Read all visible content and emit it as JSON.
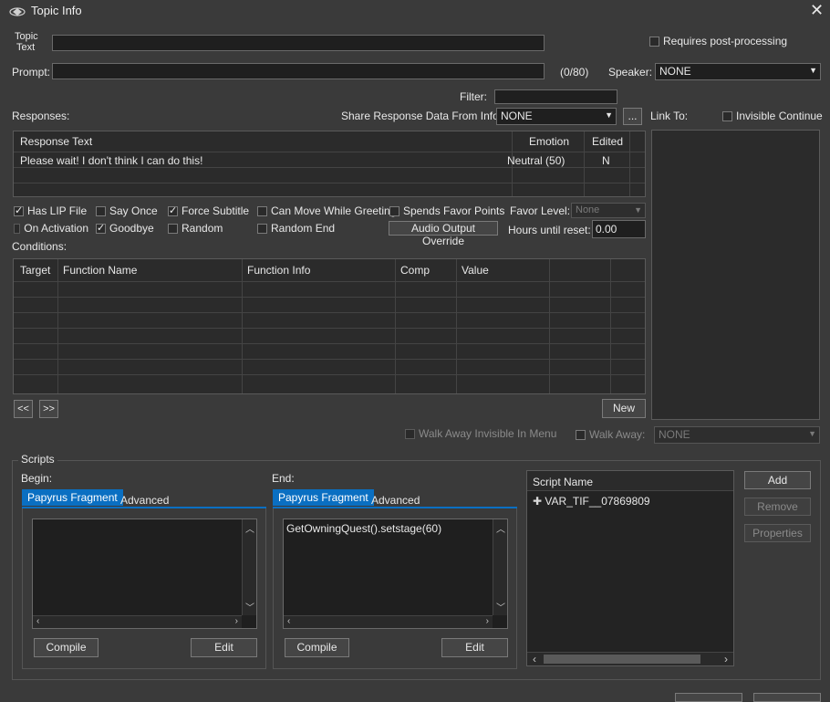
{
  "window": {
    "title": "Topic Info",
    "icon": "bethesda-logo-icon",
    "close_icon": "close-icon"
  },
  "topic": {
    "topic_text_label_line1": "Topic",
    "topic_text_label_line2": "Text",
    "topic_text_value": "",
    "prompt_label": "Prompt:",
    "prompt_value": "",
    "prompt_count": "(0/80)",
    "requires_post_processing_label": "Requires post-processing",
    "requires_post_processing_checked": false,
    "speaker_label": "Speaker:",
    "speaker_value": "NONE"
  },
  "responses": {
    "filter_label": "Filter:",
    "filter_value": "",
    "label": "Responses:",
    "share_label": "Share Response Data From Info:",
    "share_value": "NONE",
    "share_more_button": "...",
    "columns": [
      "Response Text",
      "Emotion",
      "Edited"
    ],
    "rows": [
      {
        "text": "Please wait! I don't think I can do this!",
        "emotion": "Neutral (50)",
        "edited": "N"
      }
    ]
  },
  "link_to": {
    "label": "Link To:",
    "invisible_continue_label": "Invisible Continue",
    "invisible_continue_checked": false
  },
  "flags": {
    "has_lip_file": {
      "label": "Has LIP File",
      "checked": true
    },
    "say_once": {
      "label": "Say Once",
      "checked": false
    },
    "force_subtitle": {
      "label": "Force Subtitle",
      "checked": true
    },
    "can_move_while_greeting": {
      "label": "Can Move While Greeting",
      "checked": false
    },
    "spends_favor_points": {
      "label": "Spends Favor Points",
      "checked": false
    },
    "on_activation": {
      "label": "On Activation",
      "checked": false
    },
    "goodbye": {
      "label": "Goodbye",
      "checked": true
    },
    "random": {
      "label": "Random",
      "checked": false
    },
    "random_end": {
      "label": "Random End",
      "checked": false
    },
    "favor_level_label": "Favor Level:",
    "favor_level_value": "None",
    "audio_output_override": "Audio Output Override",
    "hours_until_reset_label": "Hours until reset:",
    "hours_until_reset_value": "0.00"
  },
  "conditions": {
    "label": "Conditions:",
    "columns": [
      "Target",
      "Function Name",
      "Function Info",
      "Comp",
      "Value"
    ],
    "prev_button": "<<",
    "next_button": ">>",
    "new_button": "New"
  },
  "walk_away": {
    "invisible_in_menu_label": "Walk Away Invisible In Menu",
    "invisible_in_menu_checked": false,
    "walk_away_label": "Walk Away:",
    "walk_away_checked": false,
    "walk_away_value": "NONE"
  },
  "scripts": {
    "label": "Scripts",
    "begin_label": "Begin:",
    "end_label": "End:",
    "tab_fragment": "Papyrus Fragment",
    "tab_advanced": "Advanced",
    "begin_code": "",
    "end_code": "GetOwningQuest().setstage(60)",
    "compile_button": "Compile",
    "edit_button": "Edit",
    "script_name_header": "Script Name",
    "script_items": [
      "VAR_TIF__07869809"
    ],
    "add_button": "Add",
    "remove_button": "Remove",
    "properties_button": "Properties"
  }
}
